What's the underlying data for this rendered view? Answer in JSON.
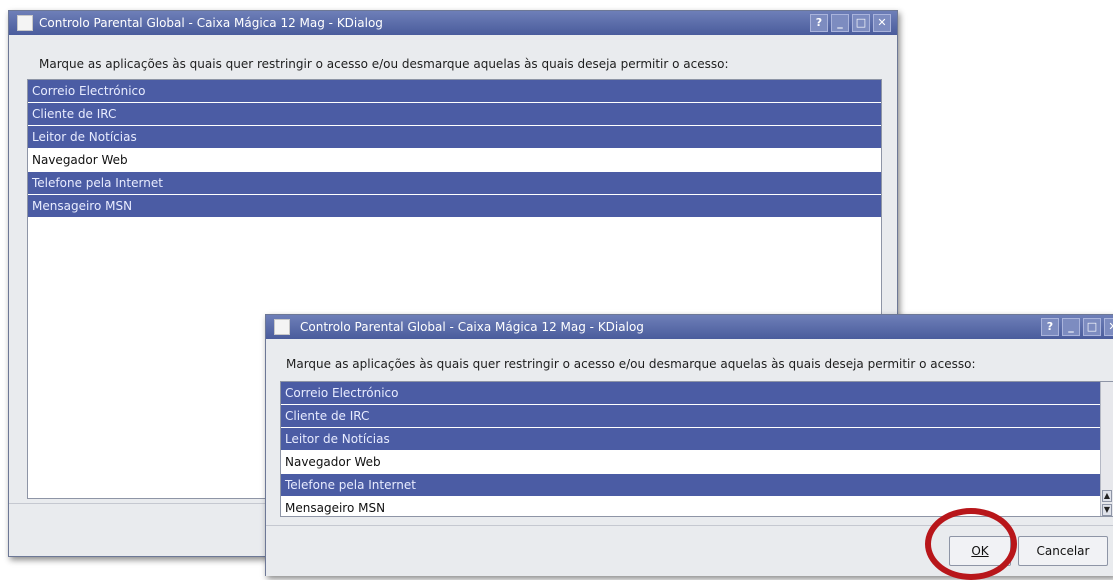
{
  "dialog_back": {
    "title": "Controlo Parental Global - Caixa Mágica 12 Mag - KDialog",
    "prompt": "Marque as aplicações às quais quer restringir o acesso e/ou desmarque aquelas às quais deseja permitir o acesso:",
    "items": [
      {
        "label": "Correio Electrónico",
        "selected": true
      },
      {
        "label": "Cliente de IRC",
        "selected": true
      },
      {
        "label": "Leitor de Notícias",
        "selected": true
      },
      {
        "label": "Navegador Web",
        "selected": false
      },
      {
        "label": "Telefone pela Internet",
        "selected": true
      },
      {
        "label": "Mensageiro MSN",
        "selected": true
      }
    ]
  },
  "dialog_front": {
    "title": "Controlo Parental Global - Caixa Mágica 12 Mag - KDialog",
    "prompt": "Marque as aplicações às quais quer restringir o acesso e/ou desmarque aquelas às quais deseja permitir o acesso:",
    "items": [
      {
        "label": "Correio Electrónico",
        "selected": true
      },
      {
        "label": "Cliente de IRC",
        "selected": true
      },
      {
        "label": "Leitor de Notícias",
        "selected": true
      },
      {
        "label": "Navegador Web",
        "selected": false
      },
      {
        "label": "Telefone pela Internet",
        "selected": true
      },
      {
        "label": "Mensageiro MSN",
        "selected": false
      }
    ],
    "ok_label": "OK",
    "cancel_label": "Cancelar"
  },
  "titlebar_buttons": {
    "help": "?",
    "minimize": "_",
    "maximize": "□",
    "close": "✕"
  },
  "colors": {
    "selected_row": "#4b5ca4",
    "titlebar": "#5a6aa8",
    "highlight_circle": "#b8161a"
  }
}
